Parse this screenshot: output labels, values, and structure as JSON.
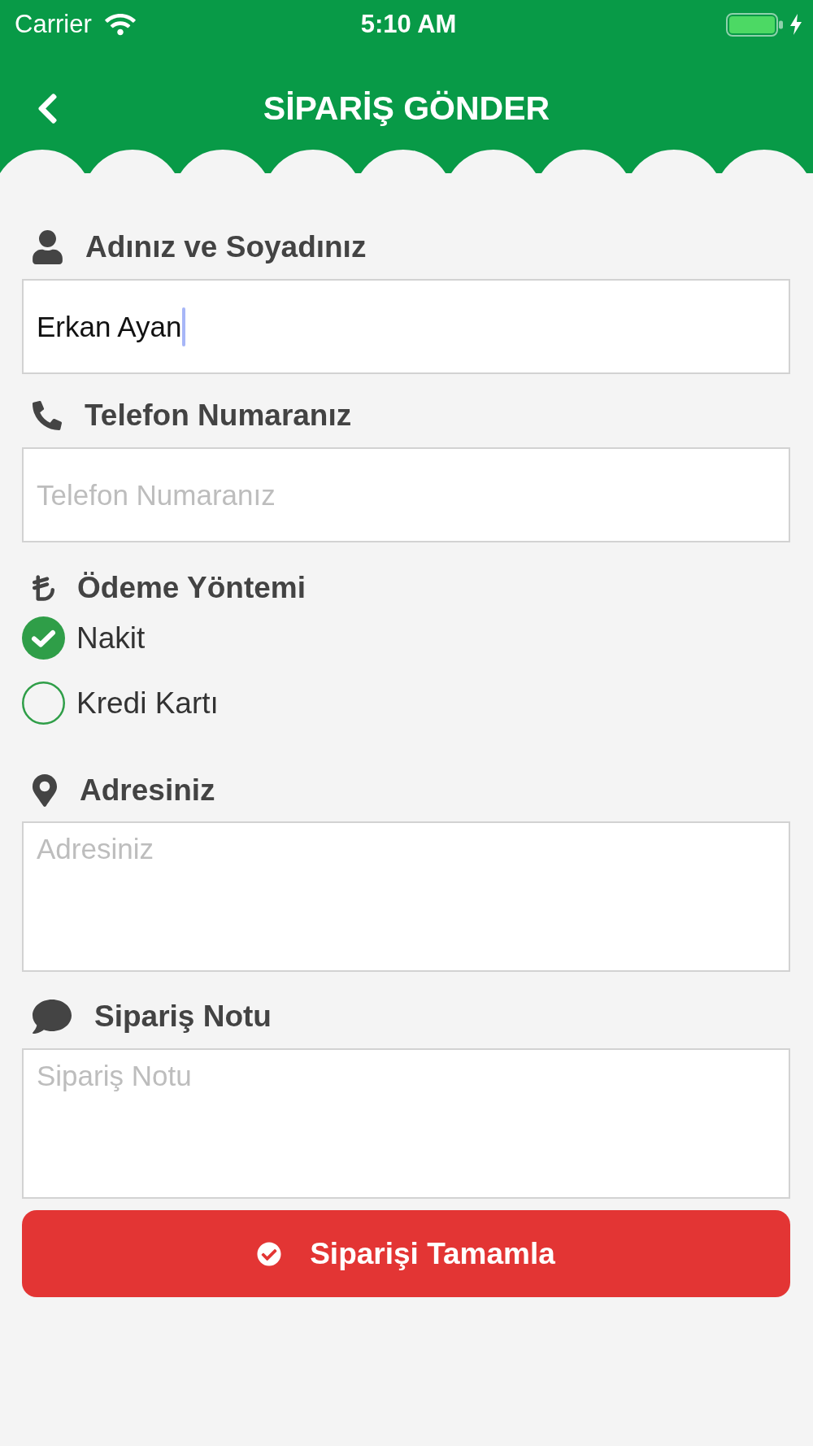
{
  "status_bar": {
    "carrier": "Carrier",
    "time": "5:10 AM"
  },
  "nav_bar": {
    "title": "SİPARİŞ GÖNDER"
  },
  "name_field": {
    "label": "Adınız ve Soyadınız",
    "value": "Erkan Ayan",
    "focused": true
  },
  "phone_field": {
    "label": "Telefon Numaranız",
    "placeholder": "Telefon Numaranız"
  },
  "payment": {
    "label": "Ödeme Yöntemi",
    "options": [
      {
        "label": "Nakit",
        "selected": true
      },
      {
        "label": "Kredi Kartı",
        "selected": false
      }
    ]
  },
  "address_field": {
    "label": "Adresiniz",
    "placeholder": "Adresiniz"
  },
  "note_field": {
    "label": "Sipariş Notu",
    "placeholder": "Sipariş Notu"
  },
  "submit_button": {
    "label": "Siparişi Tamamla"
  }
}
